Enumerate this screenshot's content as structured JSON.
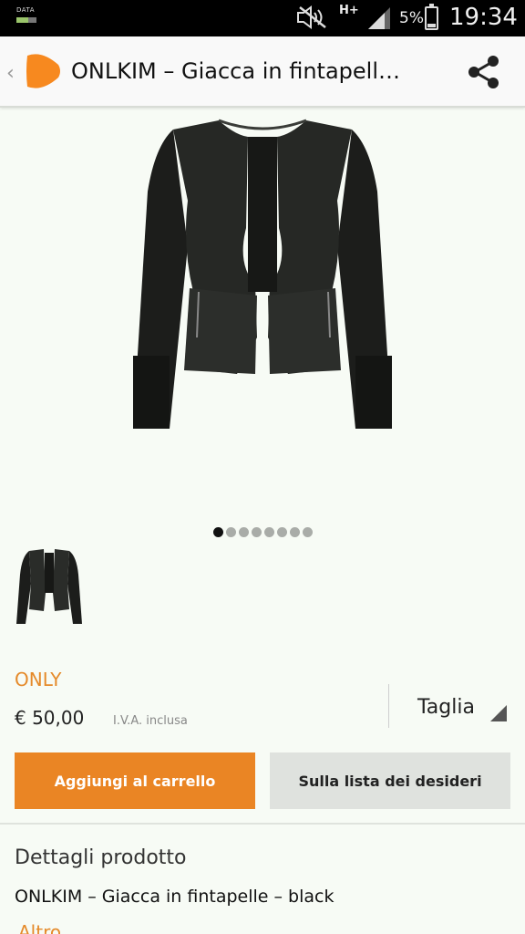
{
  "status_bar": {
    "data_label": "DATA",
    "network": "H+",
    "battery_percent": "5%",
    "battery_level": 0.05,
    "time": "19:34",
    "icons": [
      "data-icon",
      "mute-icon",
      "signal-icon",
      "battery-icon"
    ]
  },
  "header": {
    "title": "ONLKIM – Giacca in fintapell…",
    "back_glyph": "‹",
    "logo": "zalando-logo",
    "share": "share-icon",
    "accent_color": "#f7891f"
  },
  "gallery": {
    "page_count": 8,
    "active_index": 0
  },
  "product": {
    "brand": "ONLY",
    "price": "€ 50,00",
    "vat_note": "I.V.A. inclusa",
    "size_label": "Taglia"
  },
  "actions": {
    "add_to_cart": "Aggiungi al carrello",
    "wishlist": "Sulla lista dei desideri",
    "primary_color": "#ea8524"
  },
  "details": {
    "heading": "Dettagli prodotto",
    "name": "ONLKIM – Giacca in fintapelle – black",
    "more": "Altro"
  }
}
